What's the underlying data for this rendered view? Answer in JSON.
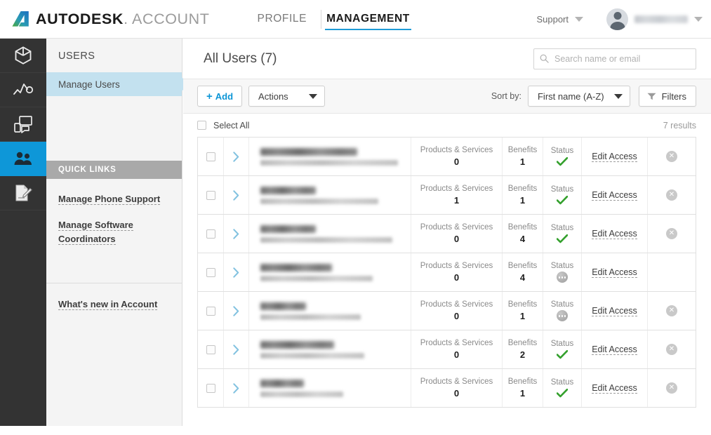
{
  "header": {
    "brand_bold": "AUTODESK",
    "brand_light": ". ACCOUNT",
    "nav": [
      {
        "label": "PROFILE",
        "active": false
      },
      {
        "label": "MANAGEMENT",
        "active": true
      }
    ],
    "support_label": "Support",
    "user_name_redacted": true
  },
  "rail": {
    "items": [
      {
        "name": "products-icon",
        "active": false
      },
      {
        "name": "insights-icon",
        "active": false
      },
      {
        "name": "devices-icon",
        "active": false
      },
      {
        "name": "users-icon",
        "active": true
      },
      {
        "name": "reports-icon",
        "active": false
      }
    ]
  },
  "sidebar": {
    "title": "USERS",
    "items": [
      {
        "label": "Manage Users",
        "active": true
      }
    ],
    "quick_links_heading": "QUICK LINKS",
    "quick_links": [
      "Manage Phone Support",
      "Manage Software Coordinators"
    ],
    "footer_link": "What's new in Account"
  },
  "main": {
    "page_title": "All Users (7)",
    "search": {
      "placeholder": "Search name or email",
      "value": ""
    },
    "toolbar": {
      "add_label": "Add",
      "add_plus": "+",
      "actions_label": "Actions",
      "sort_by_label": "Sort by:",
      "sort_value": "First name (A-Z)",
      "filters_label": "Filters"
    },
    "select_all_label": "Select All",
    "results_label": "7 results",
    "columns": {
      "products": "Products & Services",
      "benefits": "Benefits",
      "status": "Status",
      "edit": "Edit Access"
    },
    "rows": [
      {
        "name_redacted": true,
        "name_w": 138,
        "mail_w": 196,
        "products": "0",
        "benefits": "1",
        "status": "active",
        "edit_label": "Edit Access",
        "deletable": true
      },
      {
        "name_redacted": true,
        "name_w": 79,
        "mail_w": 168,
        "products": "1",
        "benefits": "1",
        "status": "active",
        "edit_label": "Edit Access",
        "deletable": true
      },
      {
        "name_redacted": true,
        "name_w": 79,
        "mail_w": 188,
        "products": "0",
        "benefits": "4",
        "status": "active",
        "edit_label": "Edit Access",
        "deletable": true
      },
      {
        "name_redacted": true,
        "name_w": 102,
        "mail_w": 160,
        "products": "0",
        "benefits": "4",
        "status": "pending",
        "edit_label": "Edit Access",
        "deletable": false
      },
      {
        "name_redacted": true,
        "name_w": 65,
        "mail_w": 143,
        "products": "0",
        "benefits": "1",
        "status": "pending",
        "edit_label": "Edit Access",
        "deletable": true
      },
      {
        "name_redacted": true,
        "name_w": 105,
        "mail_w": 148,
        "products": "0",
        "benefits": "2",
        "status": "active",
        "edit_label": "Edit Access",
        "deletable": true
      },
      {
        "name_redacted": true,
        "name_w": 62,
        "mail_w": 118,
        "products": "0",
        "benefits": "1",
        "status": "active",
        "edit_label": "Edit Access",
        "deletable": true
      }
    ]
  },
  "colors": {
    "accent_blue": "#0e97d8",
    "rail_dark": "#333333",
    "active_subnav": "#c3e1ef",
    "status_green": "#33a02c",
    "quicklinks_head": "#a9a9a9"
  }
}
